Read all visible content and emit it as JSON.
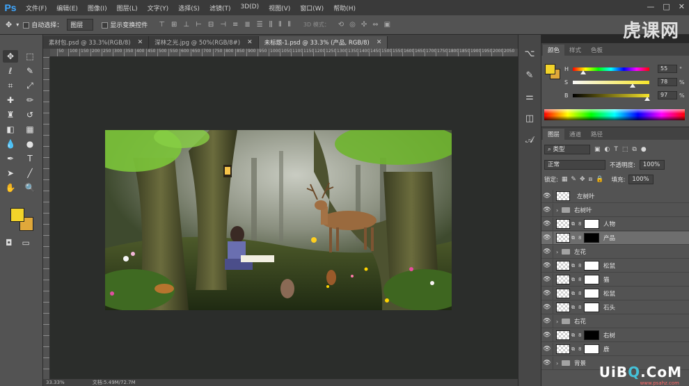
{
  "app": {
    "logo": "Ps",
    "menu": [
      "文件(F)",
      "编辑(E)",
      "图像(I)",
      "图层(L)",
      "文字(Y)",
      "选择(S)",
      "滤镜(T)",
      "3D(D)",
      "视图(V)",
      "窗口(W)",
      "帮助(H)"
    ],
    "window_controls": [
      "—",
      "□",
      "✕"
    ]
  },
  "options": {
    "auto_select_label": "自动选择：",
    "auto_select_value": "图层",
    "show_transform_label": "显示变换控件",
    "mode_3d": "3D 模式："
  },
  "watermark": "虎课网",
  "tabs": [
    {
      "label": "素材包.psd @ 33.3%(RGB/8)",
      "active": false
    },
    {
      "label": "深林之光.jpg @ 50%(RGB/8#)",
      "active": false
    },
    {
      "label": "未标题-1.psd @ 33.3% (产品, RGB/8)",
      "active": true
    }
  ],
  "ruler_ticks": [
    "0",
    "50",
    "100",
    "150",
    "200",
    "250",
    "300",
    "350",
    "400",
    "450",
    "500",
    "550",
    "600",
    "650",
    "700",
    "750",
    "800",
    "850",
    "900",
    "950",
    "1000",
    "1050",
    "1100",
    "1150",
    "1200",
    "1250",
    "1300",
    "1350",
    "1400",
    "1450",
    "1500",
    "1550",
    "1600",
    "1650",
    "1700",
    "1750",
    "1800",
    "1850",
    "1900",
    "1950",
    "2000",
    "2050"
  ],
  "status": {
    "zoom": "33.33%",
    "doc": "文档:5.49M/72.7M"
  },
  "colors": {
    "foreground": "#f2d32a",
    "background": "#e0a83a"
  },
  "color_panel": {
    "tabs": [
      "颜色",
      "样式",
      "色板"
    ],
    "sliders": [
      {
        "label": "H",
        "value": "55",
        "unit": "°",
        "position": 0.14
      },
      {
        "label": "S",
        "value": "78",
        "unit": "%",
        "position": 0.78
      },
      {
        "label": "B",
        "value": "97",
        "unit": "%",
        "position": 0.97
      }
    ]
  },
  "layers_panel": {
    "tabs": [
      "图层",
      "通道",
      "路径"
    ],
    "filter_label": "类型",
    "blend_mode": "正常",
    "opacity_label": "不透明度:",
    "opacity_value": "100%",
    "lock_label": "锁定:",
    "fill_label": "填充:",
    "fill_value": "100%",
    "layers": [
      {
        "name": "左树叶",
        "type": "layer",
        "mask": "none",
        "selected": false
      },
      {
        "name": "右树叶",
        "type": "group",
        "selected": false
      },
      {
        "name": "人物",
        "type": "layer",
        "mask": "white",
        "selected": false
      },
      {
        "name": "产品",
        "type": "layer",
        "mask": "black",
        "selected": true
      },
      {
        "name": "左花",
        "type": "group",
        "selected": false
      },
      {
        "name": "松鼠",
        "type": "layer",
        "mask": "white",
        "selected": false
      },
      {
        "name": "猫",
        "type": "layer",
        "mask": "white",
        "selected": false
      },
      {
        "name": "松鼠",
        "type": "layer",
        "mask": "white",
        "selected": false
      },
      {
        "name": "石头",
        "type": "layer",
        "mask": "white",
        "selected": false
      },
      {
        "name": "右花",
        "type": "group",
        "selected": false
      },
      {
        "name": "右树",
        "type": "layer",
        "mask": "black",
        "selected": false
      },
      {
        "name": "鹿",
        "type": "layer",
        "mask": "white",
        "selected": false
      },
      {
        "name": "背景",
        "type": "group",
        "selected": false
      }
    ]
  },
  "site_watermark": {
    "text_a": "UiB",
    "text_q": "Q",
    "text_b": ".CoM",
    "url": "www.psahz.com"
  }
}
